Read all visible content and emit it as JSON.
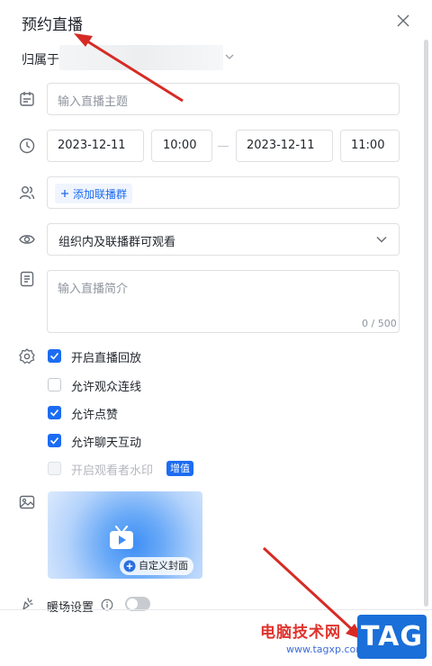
{
  "dialog": {
    "title": "预约直播",
    "owner_label": "归属于",
    "topic_placeholder": "输入直播主题",
    "start_date": "2023-12-11",
    "start_time": "10:00",
    "end_date": "2023-12-11",
    "end_time": "11:00",
    "add_group_label": "添加联播群",
    "visibility_value": "组织内及联播群可观看",
    "intro_placeholder": "输入直播简介",
    "intro_counter": "0 / 500",
    "options": [
      {
        "label": "开启直播回放",
        "checked": true,
        "disabled": false
      },
      {
        "label": "允许观众连线",
        "checked": false,
        "disabled": false
      },
      {
        "label": "允许点赞",
        "checked": true,
        "disabled": false
      },
      {
        "label": "允许聊天互动",
        "checked": true,
        "disabled": false
      },
      {
        "label": "开启观看者水印",
        "checked": false,
        "disabled": true
      }
    ],
    "watermark_badge": "增值",
    "cover_button": "自定义封面",
    "warmup_label": "暖场设置",
    "warmup_enabled": false
  },
  "watermark": {
    "site_name": "电脑技术网",
    "site_url": "www.tagxp.com",
    "tag_text": "TAG"
  },
  "colors": {
    "accent": "#1c6cf2",
    "annotation_arrow": "#d62b25"
  }
}
